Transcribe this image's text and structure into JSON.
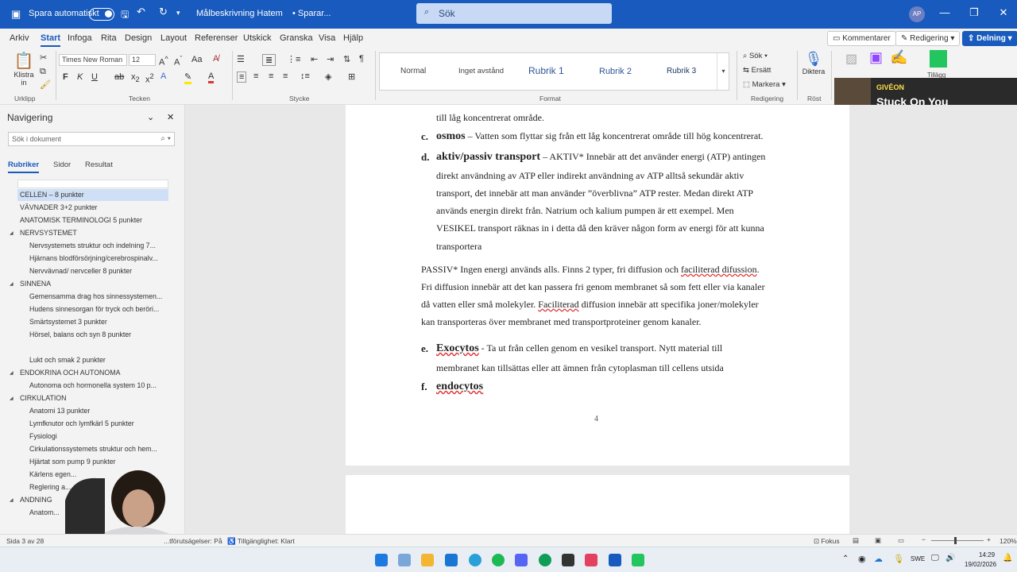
{
  "titlebar": {
    "autosave_label": "Spara automatiskt",
    "doc_title": "Målbeskrivning Hatem",
    "save_state": "• Sparar...",
    "search_placeholder": "Sök",
    "avatar_initials": "AP"
  },
  "menu": [
    "Arkiv",
    "Start",
    "Infoga",
    "Rita",
    "Design",
    "Layout",
    "Referenser",
    "Utskick",
    "Granska",
    "Visa",
    "Hjälp"
  ],
  "menu_right": {
    "comments": "Kommentarer",
    "editing": "Redigering",
    "share": "Delning"
  },
  "ribbon": {
    "paste": "Klistra in",
    "clipboard": "Urklipp",
    "font_name": "Times New Roman",
    "font_size": "12",
    "font_group": "Tecken",
    "paragraph_group": "Stycke",
    "styles": [
      "Normal",
      "Inget avstånd",
      "Rubrik 1",
      "Rubrik 2",
      "Rubrik 3"
    ],
    "styles_group": "Format",
    "find": "Sök",
    "replace": "Ersätt",
    "select": "Markera",
    "editing_group": "Redigering",
    "dictate": "Diktera",
    "voice_group": "Röst",
    "addins": "Tillägg",
    "accent": "#185abd"
  },
  "spotify": {
    "artist": "GIVĒON",
    "track": "Stuck On You"
  },
  "nav": {
    "title": "Navigering",
    "search_placeholder": "Sök i dokument",
    "tabs": [
      "Rubriker",
      "Sidor",
      "Resultat"
    ],
    "items": [
      {
        "text": "CELLEN – 8 punkter",
        "level": 1,
        "selected": true
      },
      {
        "text": "VÄVNADER 3+2 punkter",
        "level": 1
      },
      {
        "text": "ANATOMISK TERMINOLOGI 5 punkter",
        "level": 1
      },
      {
        "text": "NERVSYSTEMET",
        "level": 1,
        "expanded": true
      },
      {
        "text": "Nervsystemets struktur och indelning 7...",
        "level": 2
      },
      {
        "text": "Hjärnans blodförsörjning/cerebrospinalv...",
        "level": 2
      },
      {
        "text": "Nervvävnad/ nervceller 8 punkter",
        "level": 2
      },
      {
        "text": "SINNENA",
        "level": 1,
        "expanded": true
      },
      {
        "text": "Gemensamma drag hos sinnessystemen...",
        "level": 2
      },
      {
        "text": "Hudens sinnesorgan för tryck och beröri...",
        "level": 2
      },
      {
        "text": "Smärtsystemet 3 punkter",
        "level": 2
      },
      {
        "text": "Hörsel, balans och syn 8 punkter",
        "level": 2
      },
      {
        "text": "Lukt och smak 2 punkter",
        "level": 2
      },
      {
        "text": "ENDOKRINA OCH AUTONOMA",
        "level": 1,
        "expanded": true
      },
      {
        "text": "Autonoma och hormonella system 10 p...",
        "level": 2
      },
      {
        "text": "CIRKULATION",
        "level": 1,
        "expanded": true
      },
      {
        "text": "Anatomi 13 punkter",
        "level": 2
      },
      {
        "text": "Lymfknutor och lymfkärl 5 punkter",
        "level": 2
      },
      {
        "text": "Fysiologi",
        "level": 2
      },
      {
        "text": "Cirkulationssystemets struktur och hem...",
        "level": 2
      },
      {
        "text": "Hjärtat som pump 9 punkter",
        "level": 2
      },
      {
        "text": "Kärlens egen...",
        "level": 2
      },
      {
        "text": "Reglering a...",
        "level": 2
      },
      {
        "text": "ANDNING",
        "level": 1,
        "expanded": true
      },
      {
        "text": "Anatom...",
        "level": 2
      }
    ]
  },
  "doc": {
    "line0": "till låg koncentrerat område.",
    "c_label": "c.",
    "c_term": "osmos",
    "c_text": " – Vatten som flyttar sig från ett låg koncentrerat område till hög koncentrerat.",
    "d_label": "d.",
    "d_term": "aktiv/passiv transport",
    "d_lines": [
      " – AKTIV* Innebär att det använder energi (ATP) antingen",
      "direkt användning av ATP eller indirekt användning av ATP alltså sekundär aktiv",
      "transport, det innebär att man använder ”överblivna” ATP rester. Medan direkt ATP",
      "används energin direkt från. Natrium och kalium pumpen är ett exempel. Men",
      "VESIKEL transport räknas in i detta då den kräver någon form av energi för att kunna",
      "transportera"
    ],
    "passive_lines": [
      "PASSIV* Ingen energi används alls. Finns 2 typer, fri diffusion och ",
      "faciliterad difussion",
      ".",
      "Fri diffusion innebär att det kan passera fri genom membranet så som fett eller via kanaler",
      "då vatten eller små molekyler. ",
      "Faciliterad",
      " diffusion innebär att specifika joner/molekyler",
      "kan transporteras över membranet med transportproteiner genom kanaler."
    ],
    "e_label": "e.",
    "e_term": "Exocytos",
    "e_lines": [
      " - Ta ut från cellen genom en vesikel transport. Nytt material till",
      "membranet kan tillsättas eller att ämnen från cytoplasman till cellens utsida"
    ],
    "f_label": "f.",
    "f_term": "endocytos",
    "page_number": "4"
  },
  "status": {
    "page": "Sida 3 av 28",
    "textpred": "...tförutsägelser: På",
    "accessibility": "Tillgänglighet: Klart",
    "focus": "Fokus",
    "zoom": "120%"
  },
  "tray": {
    "lang": "SWE",
    "time": "14:29",
    "date": "19/02/2026"
  }
}
